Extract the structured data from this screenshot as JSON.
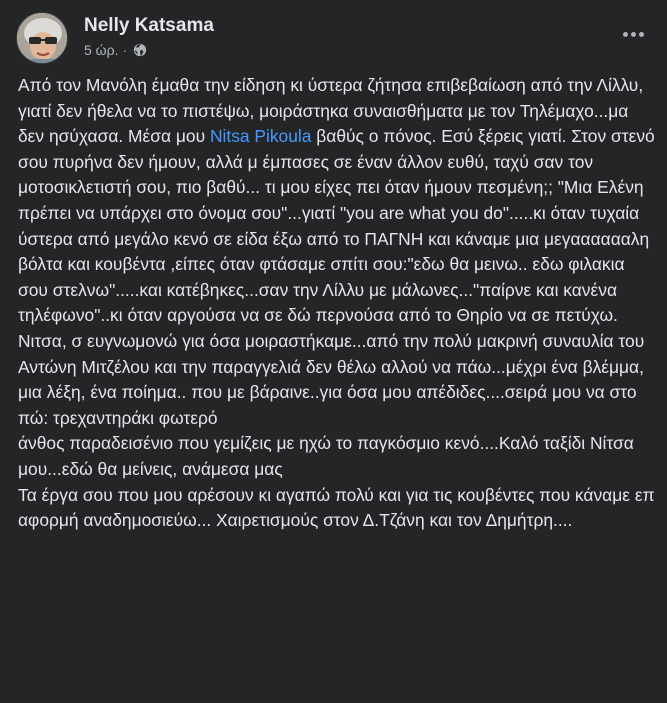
{
  "post": {
    "author_name": "Nelly Katsama",
    "timestamp": "5 ώρ.",
    "separator": "·",
    "audience_icon": "globe-icon",
    "more_icon": "more-options-icon",
    "paragraphs": [
      {
        "before": "Από τον Μανόλη έμαθα την είδηση κι ύστερα ζήτησα επιβεβαίωση από την Λίλλυ, γιατί δεν ήθελα να το πιστέψω, μοιράστηκα συναισθήματα με τον Τηλέμαχο...μα δεν ησύχασα. Μέσα μου ",
        "mention": "Nitsa Pikoula",
        "after": "  βαθύς ο πόνος. Εσύ ξέρεις γιατί.  Στον στενό σου πυρήνα δεν ήμουν, αλλά μ έμπασες σε έναν άλλον ευθύ, ταχύ σαν τον μοτοσικλετιστή σου, πιο βαθύ... τι μου είχες πει όταν ήμουν πεσμένη;; \"Μια Ελένη πρέπει να υπάρχει στο όνομα σου\"...γιατί \"you are what you do\".....κι όταν τυχαία ύστερα από μεγάλο κενό σε είδα έξω από το ΠΑΓΝΗ και κάναμε μια μεγααααααλη βόλτα και κουβέντα ,είπες όταν φτάσαμε σπίτι σου:\"εδω θα μεινω.. εδω φιλακια σου στελνω\".....και κατέβηκες...σαν την Λίλλυ με μάλωνες...\"παίρνε και κανένα τηλέφωνο\"..κι όταν αργούσα να σε δώ περνούσα από το Θηρίο να σε πετύχω."
      },
      {
        "text": "Νιτσα, σ ευγνωμονώ για όσα μοιραστήκαμε...από την πολύ μακρινή συναυλία του Αντώνη Μιτζέλου και την παραγγελιά δεν θέλω αλλού να πάω...μέχρι ένα βλέμμα,  μια λέξη, ένα ποίημα..  που με βάραινε..για όσα μου απέδιδες....σειρά μου να στο πώ: τρεχαντηράκι φωτερό"
      },
      {
        "text": "άνθος παραδεισένιο που γεμίζεις με ηχώ το παγκόσμιο κενό....Καλό ταξίδι Νίτσα μου...εδώ θα μείνεις, ανάμεσα μας"
      },
      {
        "text": "Τα έργα σου που μου αρέσουν κι αγαπώ πολύ και για τις κουβέντες που κάναμε επ αφορμή  αναδημοσιεύω... Χαιρετισμούς στον Δ.Τζάνη και τον Δημήτρη...."
      }
    ]
  }
}
